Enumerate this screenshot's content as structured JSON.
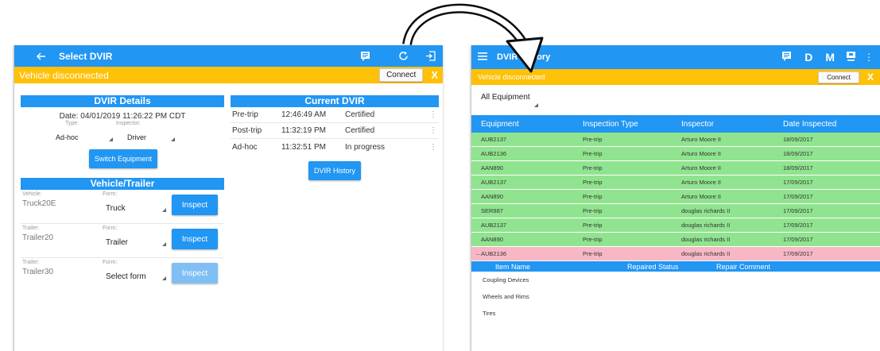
{
  "left": {
    "appbar": {
      "title": "Select DVIR",
      "icons": [
        "back-arrow-icon",
        "comment-icon",
        "refresh-icon",
        "logout-icon"
      ]
    },
    "banner": {
      "text": "Vehicle disconnected",
      "connect": "Connect",
      "close": "X"
    },
    "dvir_details": {
      "header": "DVIR Details",
      "date": "Date: 04/01/2019 11:26:22 PM CDT",
      "type_label": "Type:",
      "type_value": "Ad-hoc",
      "inspector_label": "Inspector:",
      "inspector_value": "Driver",
      "switch_button": "Switch Equipment"
    },
    "vehicle_trailer": {
      "header": "Vehicle/Trailer",
      "rows": [
        {
          "label": "Vehicle:",
          "value": "Truck20E",
          "form_label": "Form:",
          "form": "Truck",
          "button": "Inspect"
        },
        {
          "label": "Trailer:",
          "value": "Trailer20",
          "form_label": "Form:",
          "form": "Trailer",
          "button": "Inspect"
        },
        {
          "label": "Trailer:",
          "value": "Trailer30",
          "form_label": "Form:",
          "form": "Select form",
          "button": "Inspect"
        }
      ]
    },
    "current_dvir": {
      "header": "Current DVIR",
      "rows": [
        {
          "type": "Pre-trip",
          "time": "12:46:49 AM",
          "status": "Certified"
        },
        {
          "type": "Post-trip",
          "time": "11:32:19 PM",
          "status": "Certified"
        },
        {
          "type": "Ad-hoc",
          "time": "11:32:51 PM",
          "status": "In progress"
        }
      ],
      "history_button": "DVIR History"
    }
  },
  "right": {
    "appbar": {
      "title": "DVIR History",
      "letters": [
        "D",
        "M"
      ],
      "icons": [
        "menu-icon",
        "comment-icon",
        "person-icon",
        "more-icon"
      ]
    },
    "banner": {
      "text": "Vehicle disconnected",
      "connect": "Connect",
      "close": "X"
    },
    "filter": "All Equipment",
    "table": {
      "headers": [
        "Equipment",
        "Inspection Type",
        "Inspector",
        "Date Inspected"
      ],
      "rows": [
        {
          "equipment": "AUB2137",
          "type": "Pre-trip",
          "inspector": "Arturo Moore II",
          "date": "18/09/2017",
          "status": "ok"
        },
        {
          "equipment": "AUB2136",
          "type": "Pre-trip",
          "inspector": "Arturo Moore II",
          "date": "18/09/2017",
          "status": "ok"
        },
        {
          "equipment": "AAN890",
          "type": "Pre-trip",
          "inspector": "Arturo Moore II",
          "date": "18/09/2017",
          "status": "ok"
        },
        {
          "equipment": "AUB2137",
          "type": "Pre-trip",
          "inspector": "Arturo Moore II",
          "date": "17/09/2017",
          "status": "ok"
        },
        {
          "equipment": "AAN890",
          "type": "Pre-trip",
          "inspector": "Arturo Moore II",
          "date": "17/09/2017",
          "status": "ok"
        },
        {
          "equipment": "SER987",
          "type": "Pre-trip",
          "inspector": "douglas richards II",
          "date": "17/09/2017",
          "status": "ok"
        },
        {
          "equipment": "AUB2137",
          "type": "Pre-trip",
          "inspector": "douglas richards II",
          "date": "17/09/2017",
          "status": "ok"
        },
        {
          "equipment": "AAN890",
          "type": "Pre-trip",
          "inspector": "douglas richards II",
          "date": "17/09/2017",
          "status": "ok"
        },
        {
          "equipment": "AUB2136",
          "type": "Pre-trip",
          "inspector": "douglas richards II",
          "date": "17/09/2017",
          "status": "defect",
          "expanded": true
        }
      ]
    },
    "subtable": {
      "headers": [
        "Item Name",
        "Repaired Status",
        "Repair Comment"
      ],
      "items": [
        "Coupling Devices",
        "Wheels and Rims",
        "Tires"
      ]
    }
  },
  "colors": {
    "blue": "#2196f3",
    "amber": "#ffc107",
    "ok": "#90e48f",
    "defect": "#f8b7c4",
    "arrow": "#2196f3"
  }
}
